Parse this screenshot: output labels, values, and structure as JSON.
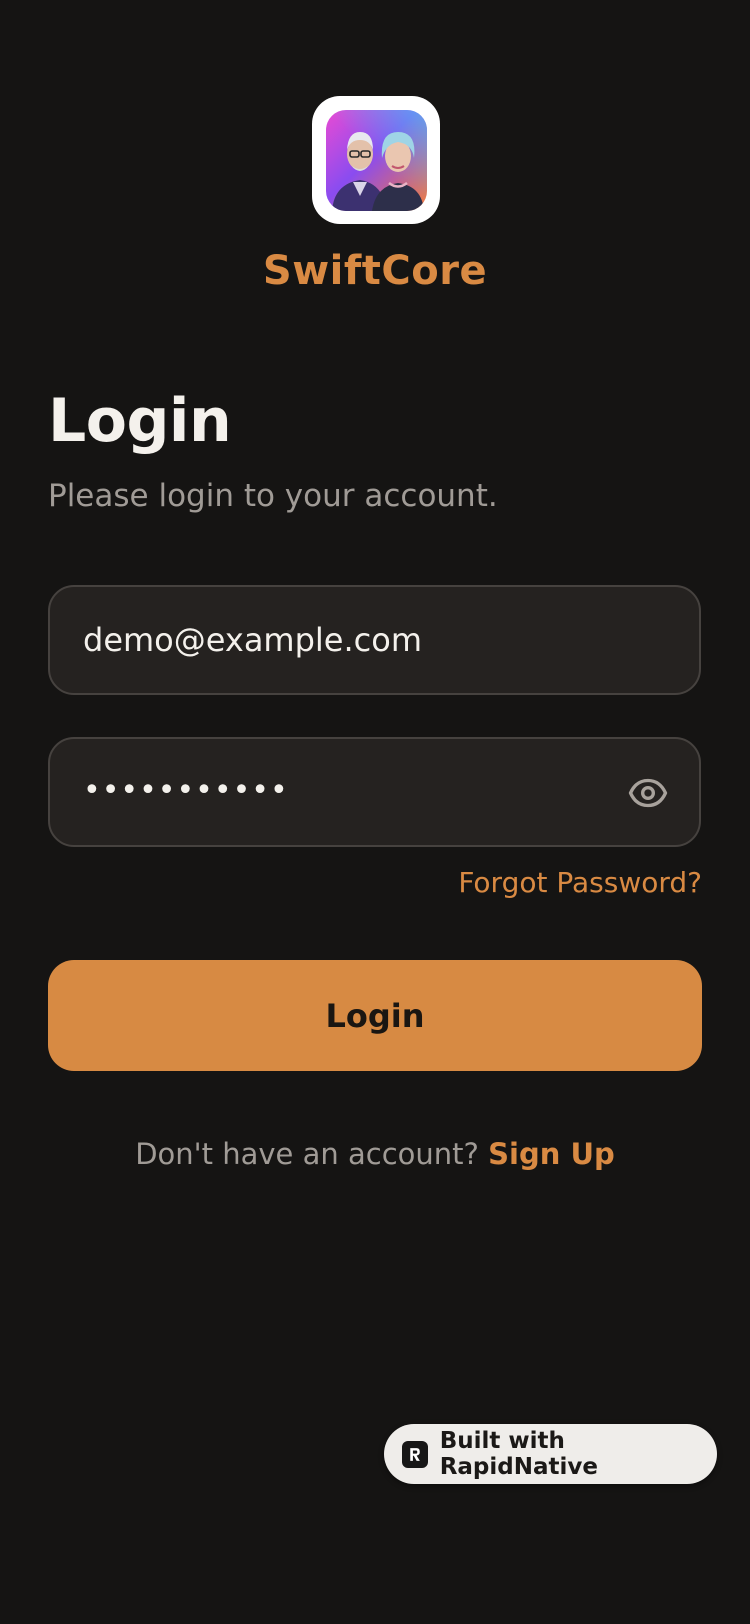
{
  "app": {
    "name": "SwiftCore",
    "accent_color": "#d98a43",
    "background_color": "#151413",
    "icon": "couple-portrait-app-icon"
  },
  "login": {
    "title": "Login",
    "subtitle": "Please login to your account.",
    "email_value": "demo@example.com",
    "password_masked": "•••••••••••",
    "password_toggle_icon": "eye-icon",
    "forgot_password_label": "Forgot Password?",
    "submit_label": "Login"
  },
  "signup": {
    "prompt": "Don't have an account?",
    "link_label": "Sign Up"
  },
  "badge": {
    "label": "Built with RapidNative",
    "icon": "rapidnative-logo-icon"
  }
}
